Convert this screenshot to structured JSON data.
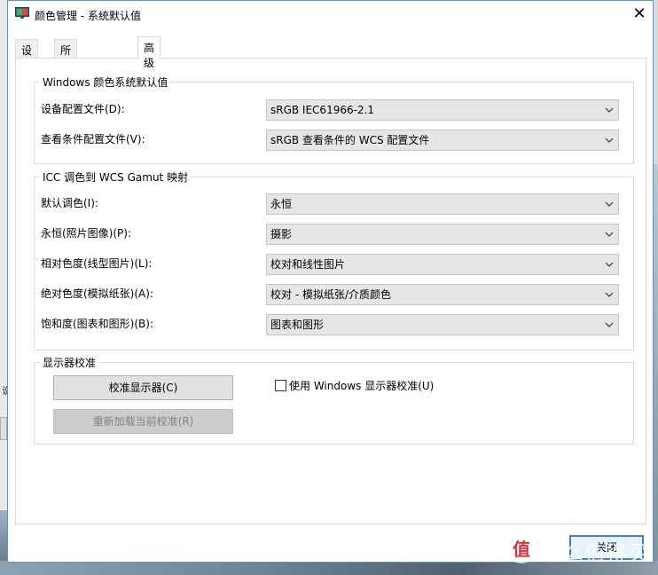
{
  "window": {
    "title": "颜色管理 - 系统默认值",
    "close_glyph": "✕"
  },
  "tabs": [
    {
      "label": "设备",
      "active": false
    },
    {
      "label": "所有配置文件",
      "active": false
    },
    {
      "label": "高级",
      "active": true
    }
  ],
  "windows_defaults": {
    "legend": "Windows 颜色系统默认值",
    "rows": [
      {
        "label": "设备配置文件(D):",
        "value": "sRGB IEC61966-2.1"
      },
      {
        "label": "查看条件配置文件(V):",
        "value": "sRGB 查看条件的 WCS 配置文件"
      }
    ]
  },
  "gamut_mapping": {
    "legend": "ICC 调色到 WCS Gamut 映射",
    "rows": [
      {
        "label": "默认调色(I):",
        "value": "永恒"
      },
      {
        "label": "永恒(照片图像)(P):",
        "value": "摄影"
      },
      {
        "label": "相对色度(线型图片)(L):",
        "value": "校对和线性图片"
      },
      {
        "label": "绝对色度(模拟纸张)(A):",
        "value": "校对 - 模拟纸张/介质颜色"
      },
      {
        "label": "饱和度(图表和图形)(B):",
        "value": "图表和图形"
      }
    ]
  },
  "calibration": {
    "legend": "显示器校准",
    "calibrate_button": "校准显示器(C)",
    "reload_button": "重新加载当前校准(R)",
    "use_windows_calibration": {
      "label": "使用 Windows 显示器校准(U)",
      "checked": false
    }
  },
  "footer": {
    "ok_button": "关闭"
  },
  "background": {
    "left_label": "说"
  },
  "watermark": {
    "glyph": "值",
    "text": "什么值得买"
  },
  "colors": {
    "combo_bg": "#e6e6e6",
    "button_bg": "#e1e1e1",
    "focus_border": "#3c7fd1"
  }
}
